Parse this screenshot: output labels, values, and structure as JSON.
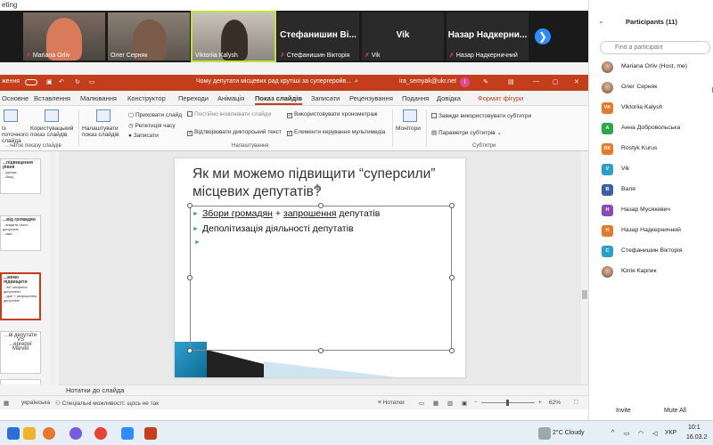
{
  "zoom": {
    "window_title": "eting",
    "tiles": [
      {
        "name": "Mariana Orliv",
        "type": "cam",
        "muted": true
      },
      {
        "name": "Олег Серняк",
        "type": "cam",
        "muted": false
      },
      {
        "name": "Viktoriia Kalysh",
        "type": "cam",
        "muted": false,
        "active": true
      },
      {
        "name": "Стефанишин Ві...",
        "caption": "Стефанишин Вікторія",
        "type": "name",
        "muted": true
      },
      {
        "name": "Vik",
        "caption": "Vik",
        "type": "name",
        "muted": true
      },
      {
        "name": "Назар Надкерни...",
        "caption": "Назар Надкерничний",
        "type": "name",
        "muted": true
      }
    ],
    "next_glyph": "❯"
  },
  "ppt": {
    "autosave_label": "ження",
    "doc_title": "Чому депутати місцевих рад крутіші за супергеройв... ",
    "account": "ira_semyak@ukr.net",
    "account_badge": "I",
    "tabs": [
      "Основне",
      "Вставлення",
      "Малювання",
      "Конструктор",
      "Переходи",
      "Анімація",
      "Показ слайдів",
      "Записати",
      "Рецензування",
      "Подання",
      "Довідка",
      "Формат фігури"
    ],
    "active_tab": "Показ слайдів",
    "ribbon": {
      "from_start": "Із поточного слайда",
      "custom_show": "Користувацький показ слайдів",
      "setup_show": "Налаштувати показ слайдів",
      "hide_slide": "Приховати слайд",
      "rehearse": "Репетиція часу",
      "record": "Записати",
      "play_narrations": "Постійно іновлювати слайди",
      "use_timings": "Використовувати хронометраж",
      "show_narrations": "Відтворювати дикторський текст",
      "show_media": "Елементи керування мультимедіа",
      "group_setup": "Налаштування",
      "group_start": "...чаток показу слайдів",
      "monitors": "Монітори",
      "always_subtitles": "Завжди використовувати субтитри",
      "subtitle_settings": "Параметри субтитрів",
      "group_subtitles": "Субтитри"
    },
    "thumbs": [
      {
        "line1": "...підвищення рівня",
        "line2": "...ідтерм",
        "line3": "...базц"
      },
      {
        "line1": "...від громадян",
        "line2": "...вищити часть депутатів",
        "line3": "...ажи"
      },
      {
        "line1": "...жемо підвищити",
        "line2": "...ви\" місцевих депутатів?",
        "line3": "...дян + запрошення депутатів"
      },
      {
        "line1": "...ві депутати",
        "line2": "VS",
        "line3": "...ергерої Marvel"
      }
    ],
    "slide": {
      "title": "Як ми можемо підвищити “суперсили” місцевих депутатів?",
      "bullet1_part1": "Збори громадян",
      "bullet1_plus": " + ",
      "bullet1_part2": "запрошення",
      "bullet1_part3": " депутатів",
      "bullet2": "Деполітизація діяльності депутатів"
    },
    "notes_label": "Нотатки до слайда",
    "status": {
      "language": "українська",
      "accessibility": "Спеціальні можливості: щось не так",
      "notes": "Нотатки",
      "zoom": "62%"
    }
  },
  "participants": {
    "header": "Participants (11)",
    "search_placeholder": "Find a participant",
    "list": [
      {
        "name": "Mariana Orliv (Host, me)",
        "initials": "",
        "photo": true,
        "color": ""
      },
      {
        "name": "Олег Серняк",
        "initials": "",
        "photo": true,
        "color": ""
      },
      {
        "name": "Viktoriia Kalysh",
        "initials": "VK",
        "photo": false,
        "color": "#e8782a"
      },
      {
        "name": "Анна Добровольська",
        "initials": "A",
        "photo": false,
        "color": "#2ba84a"
      },
      {
        "name": "Rostyk Kurus",
        "initials": "RK",
        "photo": false,
        "color": "#e8782a"
      },
      {
        "name": "Vik",
        "initials": "V",
        "photo": false,
        "color": "#2aa0c8"
      },
      {
        "name": "Валя",
        "initials": "В",
        "photo": false,
        "color": "#3b5fa8"
      },
      {
        "name": "Назар Мусякевич",
        "initials": "Н",
        "photo": false,
        "color": "#8a4bb8"
      },
      {
        "name": "Назар Надкерничний",
        "initials": "Н",
        "photo": false,
        "color": "#e8782a"
      },
      {
        "name": "Стефанишин Вікторія",
        "initials": "С",
        "photo": false,
        "color": "#2aa0c8"
      },
      {
        "name": "Юлія Карпик",
        "initials": "",
        "photo": true,
        "color": ""
      }
    ],
    "invite_label": "Invite",
    "mute_all_label": "Mute All"
  },
  "taskbar": {
    "weather": "2°C  Cloudy",
    "lang": "УКР",
    "time": "10:1",
    "date": "16.03.2"
  }
}
